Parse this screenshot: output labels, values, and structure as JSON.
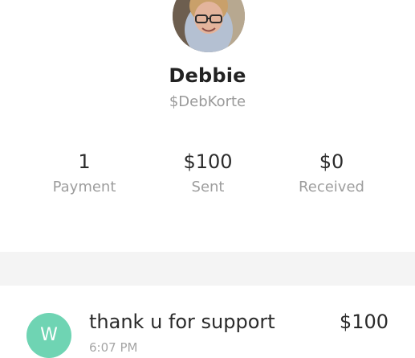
{
  "profile": {
    "name": "Debbie",
    "cashtag": "$DebKorte",
    "avatar_icon": "user-photo"
  },
  "stats": {
    "payments": {
      "value": "1",
      "label": "Payment"
    },
    "sent": {
      "value": "$100",
      "label": "Sent"
    },
    "received": {
      "value": "$0",
      "label": "Received"
    }
  },
  "activity": [
    {
      "avatar_letter": "W",
      "avatar_color": "#6fd4b3",
      "title": "thank u for support",
      "amount": "$100",
      "time": "6:07 PM"
    }
  ]
}
